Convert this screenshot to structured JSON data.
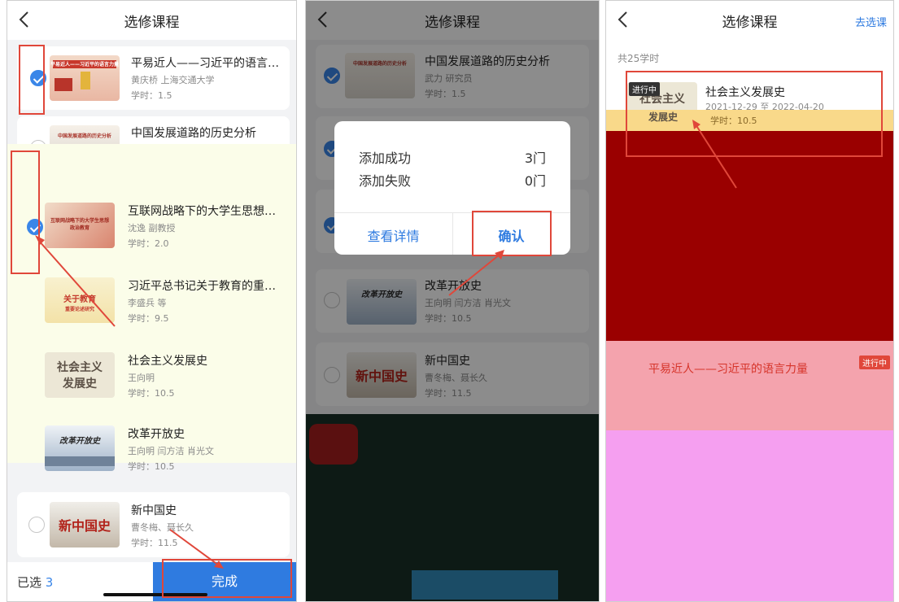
{
  "nav_title": "选修课程",
  "screen3_right_link": "去选课",
  "courses": [
    {
      "title": "平易近人——习近平的语言力量",
      "author": "黄庆桥 上海交通大学",
      "hours": "学时：1.5"
    },
    {
      "title": "中国发展道路的历史分析",
      "author": "武力 研究员",
      "hours": "学时：1.5"
    },
    {
      "title": "互联网战略下的大学生思想政...",
      "author": "沈逸 副教授",
      "hours": "学时：2.0"
    },
    {
      "title": "习近平总书记关于教育的重要...",
      "author": "李盛兵 等",
      "hours": "学时：9.5"
    },
    {
      "title": "社会主义发展史",
      "author": "王向明",
      "hours": "学时：10.5"
    },
    {
      "title": "改革开放史",
      "author": "王向明 闫方洁 肖光文",
      "hours": "学时：10.5"
    },
    {
      "title": "新中国史",
      "author": "曹冬梅、聂长久",
      "hours": "学时：11.5"
    }
  ],
  "thumb_texts": {
    "zhongguo": "中国发展道路的历史分析",
    "hulianwang": "互联网战略下的大学生思想政治教育",
    "jiaoyu_main": "关于教育",
    "jiaoyu_sub": "重要论述研究",
    "shehui_top": "社会主义",
    "shehui_bottom": "发展史",
    "gaige": "改革开放史",
    "xinzhongguo": "新中国史",
    "pingyi": "平易近人——习近平的语言力量"
  },
  "bottom_bar": {
    "selected_label": "已选",
    "selected_count": "3",
    "done_label": "完成"
  },
  "dialog": {
    "success_label": "添加成功",
    "success_value": "3门",
    "fail_label": "添加失败",
    "fail_value": "0门",
    "detail_button": "查看详情",
    "confirm_button": "确认"
  },
  "screen3": {
    "total_hours": "共25学时",
    "status_tag": "进行中",
    "course_title": "社会主义发展史",
    "course_dates": "2021-12-29 至 2022-04-20",
    "course_hours": "学时：10.5",
    "second_title": "平易近人——习近平的语言力量",
    "second_tag": "进行中"
  },
  "colors": {
    "accent": "#2f7be0",
    "annotation_red": "#e0473a"
  }
}
